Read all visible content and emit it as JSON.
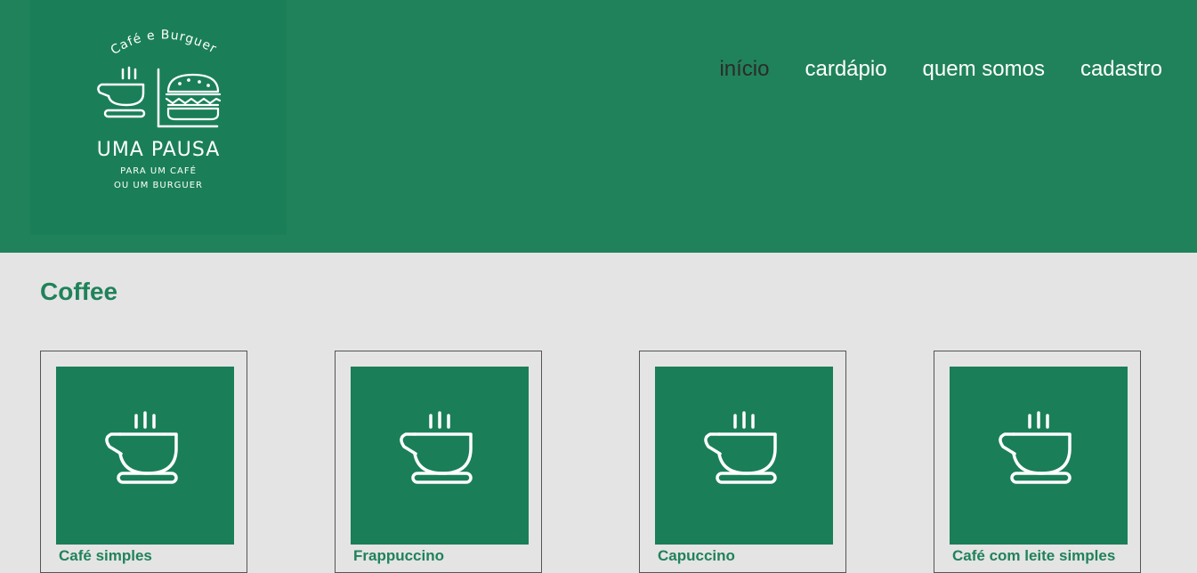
{
  "logo": {
    "arc_text": "Café e Burguer",
    "title": "UMA PAUSA",
    "subtitle_line1": "PARA UM CAFÉ",
    "subtitle_line2": "OU UM BURGUER"
  },
  "nav": {
    "items": [
      {
        "label": "início",
        "active": true
      },
      {
        "label": "cardápio",
        "active": false
      },
      {
        "label": "quem somos",
        "active": false
      },
      {
        "label": "cadastro",
        "active": false
      }
    ]
  },
  "section": {
    "title": "Coffee"
  },
  "products": [
    {
      "name": "Café simples",
      "icon": "coffee-cup-icon"
    },
    {
      "name": "Frappuccino",
      "icon": "coffee-cup-icon"
    },
    {
      "name": "Capuccino",
      "icon": "coffee-cup-icon"
    },
    {
      "name": "Café com leite simples",
      "icon": "coffee-cup-icon"
    }
  ],
  "colors": {
    "header_bg": "#20825a",
    "logo_bg": "#1a7f58",
    "page_bg": "#e4e4e4",
    "accent": "#20825a",
    "nav_active": "#2b2b2b",
    "nav_text": "#ffffff"
  }
}
